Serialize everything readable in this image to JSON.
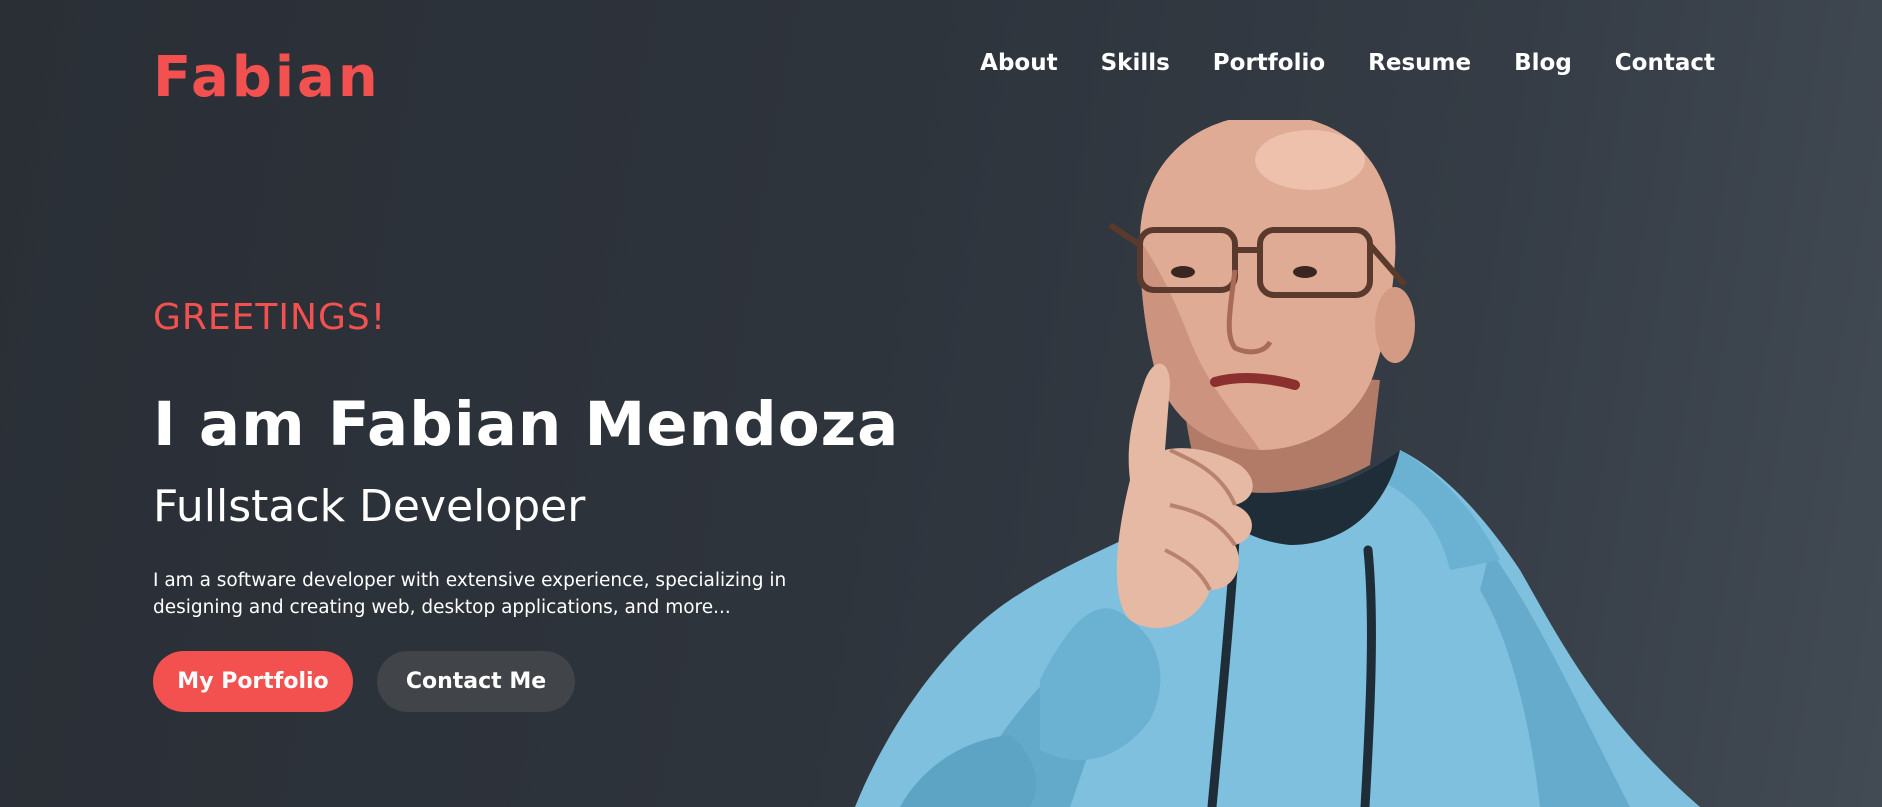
{
  "header": {
    "logo": "Fabian",
    "nav": [
      {
        "label": "About"
      },
      {
        "label": "Skills"
      },
      {
        "label": "Portfolio"
      },
      {
        "label": "Resume"
      },
      {
        "label": "Blog"
      },
      {
        "label": "Contact"
      }
    ]
  },
  "hero": {
    "greeting": "GREETINGS!",
    "name": "I am Fabian Mendoza",
    "role": "Fullstack Developer",
    "description_line1": "I am a software developer with extensive experience, specializing in",
    "description_line2": "designing and creating web, desktop applications, and more...",
    "primary_button": "My Portfolio",
    "secondary_button": "Contact Me"
  },
  "colors": {
    "accent": "#f2514f",
    "background": "#2e343c",
    "secondary_button": "#414448",
    "hoodie": "#7ec0dd"
  }
}
